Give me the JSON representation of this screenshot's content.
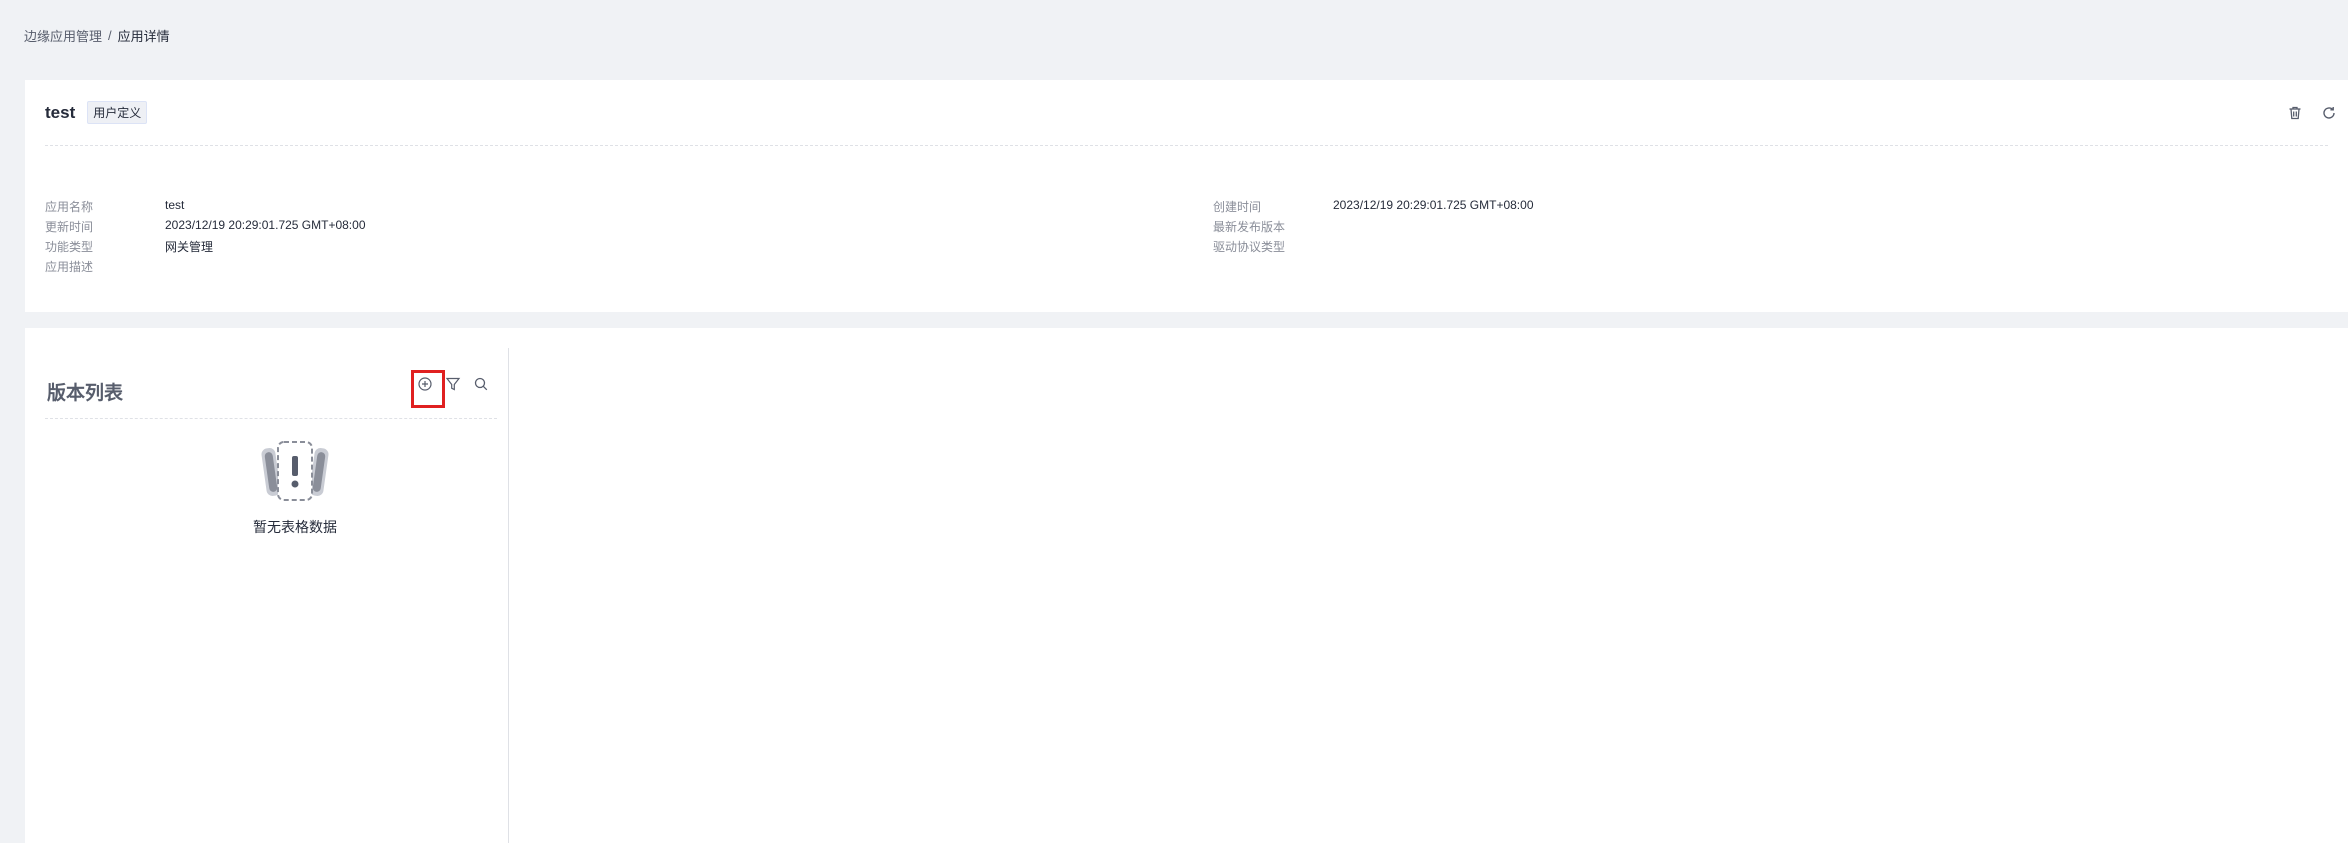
{
  "breadcrumb": {
    "parent": "边缘应用管理",
    "separator": "/",
    "current": "应用详情"
  },
  "app": {
    "name": "test",
    "tag": "用户定义"
  },
  "fields": {
    "app_name": {
      "label": "应用名称",
      "value": "test"
    },
    "updated": {
      "label": "更新时间",
      "value": "2023/12/19 20:29:01.725 GMT+08:00"
    },
    "function_type": {
      "label": "功能类型",
      "value": "网关管理"
    },
    "description": {
      "label": "应用描述",
      "value": ""
    },
    "created": {
      "label": "创建时间",
      "value": "2023/12/19 20:29:01.725 GMT+08:00"
    },
    "latest_version": {
      "label": "最新发布版本",
      "value": ""
    },
    "driver_protocol": {
      "label": "驱动协议类型",
      "value": ""
    }
  },
  "version_list": {
    "title": "版本列表",
    "empty_text": "暂无表格数据"
  },
  "icons": {
    "delete": "trash-icon",
    "refresh": "refresh-icon",
    "add": "add-circle-icon",
    "filter": "filter-icon",
    "search": "search-icon"
  },
  "colors": {
    "highlight": "#e02020",
    "background": "#f0f2f5",
    "card": "#ffffff"
  }
}
